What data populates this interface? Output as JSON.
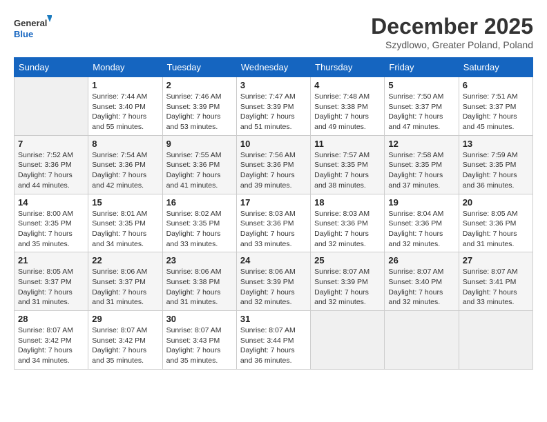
{
  "header": {
    "logo_general": "General",
    "logo_blue": "Blue",
    "month_title": "December 2025",
    "subtitle": "Szydlowo, Greater Poland, Poland"
  },
  "days_of_week": [
    "Sunday",
    "Monday",
    "Tuesday",
    "Wednesday",
    "Thursday",
    "Friday",
    "Saturday"
  ],
  "weeks": [
    [
      {
        "day": "",
        "info": ""
      },
      {
        "day": "1",
        "info": "Sunrise: 7:44 AM\nSunset: 3:40 PM\nDaylight: 7 hours\nand 55 minutes."
      },
      {
        "day": "2",
        "info": "Sunrise: 7:46 AM\nSunset: 3:39 PM\nDaylight: 7 hours\nand 53 minutes."
      },
      {
        "day": "3",
        "info": "Sunrise: 7:47 AM\nSunset: 3:39 PM\nDaylight: 7 hours\nand 51 minutes."
      },
      {
        "day": "4",
        "info": "Sunrise: 7:48 AM\nSunset: 3:38 PM\nDaylight: 7 hours\nand 49 minutes."
      },
      {
        "day": "5",
        "info": "Sunrise: 7:50 AM\nSunset: 3:37 PM\nDaylight: 7 hours\nand 47 minutes."
      },
      {
        "day": "6",
        "info": "Sunrise: 7:51 AM\nSunset: 3:37 PM\nDaylight: 7 hours\nand 45 minutes."
      }
    ],
    [
      {
        "day": "7",
        "info": "Sunrise: 7:52 AM\nSunset: 3:36 PM\nDaylight: 7 hours\nand 44 minutes."
      },
      {
        "day": "8",
        "info": "Sunrise: 7:54 AM\nSunset: 3:36 PM\nDaylight: 7 hours\nand 42 minutes."
      },
      {
        "day": "9",
        "info": "Sunrise: 7:55 AM\nSunset: 3:36 PM\nDaylight: 7 hours\nand 41 minutes."
      },
      {
        "day": "10",
        "info": "Sunrise: 7:56 AM\nSunset: 3:36 PM\nDaylight: 7 hours\nand 39 minutes."
      },
      {
        "day": "11",
        "info": "Sunrise: 7:57 AM\nSunset: 3:35 PM\nDaylight: 7 hours\nand 38 minutes."
      },
      {
        "day": "12",
        "info": "Sunrise: 7:58 AM\nSunset: 3:35 PM\nDaylight: 7 hours\nand 37 minutes."
      },
      {
        "day": "13",
        "info": "Sunrise: 7:59 AM\nSunset: 3:35 PM\nDaylight: 7 hours\nand 36 minutes."
      }
    ],
    [
      {
        "day": "14",
        "info": "Sunrise: 8:00 AM\nSunset: 3:35 PM\nDaylight: 7 hours\nand 35 minutes."
      },
      {
        "day": "15",
        "info": "Sunrise: 8:01 AM\nSunset: 3:35 PM\nDaylight: 7 hours\nand 34 minutes."
      },
      {
        "day": "16",
        "info": "Sunrise: 8:02 AM\nSunset: 3:35 PM\nDaylight: 7 hours\nand 33 minutes."
      },
      {
        "day": "17",
        "info": "Sunrise: 8:03 AM\nSunset: 3:36 PM\nDaylight: 7 hours\nand 33 minutes."
      },
      {
        "day": "18",
        "info": "Sunrise: 8:03 AM\nSunset: 3:36 PM\nDaylight: 7 hours\nand 32 minutes."
      },
      {
        "day": "19",
        "info": "Sunrise: 8:04 AM\nSunset: 3:36 PM\nDaylight: 7 hours\nand 32 minutes."
      },
      {
        "day": "20",
        "info": "Sunrise: 8:05 AM\nSunset: 3:36 PM\nDaylight: 7 hours\nand 31 minutes."
      }
    ],
    [
      {
        "day": "21",
        "info": "Sunrise: 8:05 AM\nSunset: 3:37 PM\nDaylight: 7 hours\nand 31 minutes."
      },
      {
        "day": "22",
        "info": "Sunrise: 8:06 AM\nSunset: 3:37 PM\nDaylight: 7 hours\nand 31 minutes."
      },
      {
        "day": "23",
        "info": "Sunrise: 8:06 AM\nSunset: 3:38 PM\nDaylight: 7 hours\nand 31 minutes."
      },
      {
        "day": "24",
        "info": "Sunrise: 8:06 AM\nSunset: 3:39 PM\nDaylight: 7 hours\nand 32 minutes."
      },
      {
        "day": "25",
        "info": "Sunrise: 8:07 AM\nSunset: 3:39 PM\nDaylight: 7 hours\nand 32 minutes."
      },
      {
        "day": "26",
        "info": "Sunrise: 8:07 AM\nSunset: 3:40 PM\nDaylight: 7 hours\nand 32 minutes."
      },
      {
        "day": "27",
        "info": "Sunrise: 8:07 AM\nSunset: 3:41 PM\nDaylight: 7 hours\nand 33 minutes."
      }
    ],
    [
      {
        "day": "28",
        "info": "Sunrise: 8:07 AM\nSunset: 3:42 PM\nDaylight: 7 hours\nand 34 minutes."
      },
      {
        "day": "29",
        "info": "Sunrise: 8:07 AM\nSunset: 3:42 PM\nDaylight: 7 hours\nand 35 minutes."
      },
      {
        "day": "30",
        "info": "Sunrise: 8:07 AM\nSunset: 3:43 PM\nDaylight: 7 hours\nand 35 minutes."
      },
      {
        "day": "31",
        "info": "Sunrise: 8:07 AM\nSunset: 3:44 PM\nDaylight: 7 hours\nand 36 minutes."
      },
      {
        "day": "",
        "info": ""
      },
      {
        "day": "",
        "info": ""
      },
      {
        "day": "",
        "info": ""
      }
    ]
  ]
}
